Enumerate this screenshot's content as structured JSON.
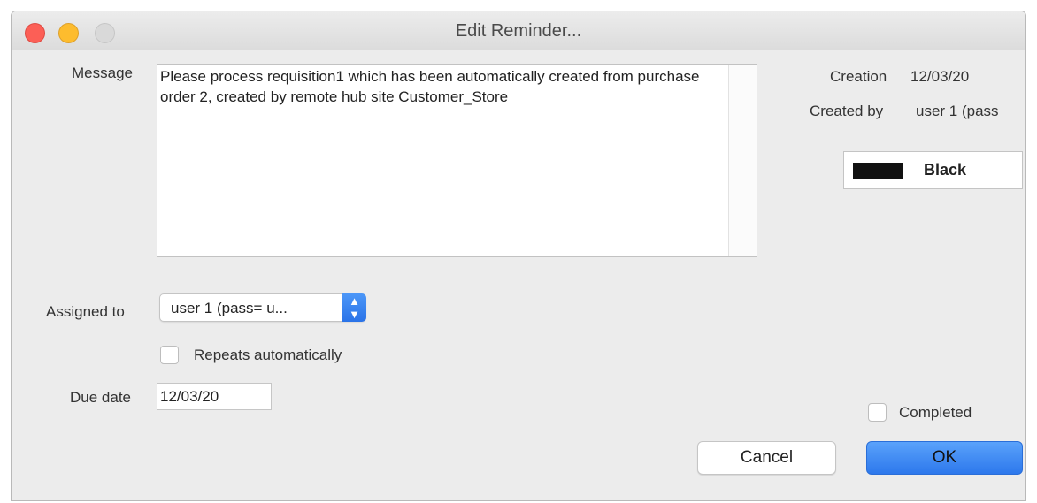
{
  "window": {
    "title": "Edit Reminder..."
  },
  "message": {
    "label": "Message",
    "text": "Please process requisition1 which has been automatically created from purchase order 2, created by remote hub site Customer_Store"
  },
  "info": {
    "creation_label": "Creation",
    "creation_value": "12/03/20",
    "created_by_label": "Created by",
    "created_by_value": "user 1 (pass"
  },
  "color": {
    "swatch_hex": "#111111",
    "name": "Black"
  },
  "assigned": {
    "label": "Assigned to",
    "value": "user 1 (pass= u..."
  },
  "repeats": {
    "label": "Repeats automatically",
    "checked": false
  },
  "due_date": {
    "label": "Due date",
    "value": "12/03/20"
  },
  "completed": {
    "label": "Completed",
    "checked": false
  },
  "buttons": {
    "cancel": "Cancel",
    "ok": "OK"
  },
  "colors": {
    "accent": "#2d78ec",
    "close": "#fc5f56",
    "minimize": "#fdbc2e",
    "zoom": "#d9d9d9"
  }
}
